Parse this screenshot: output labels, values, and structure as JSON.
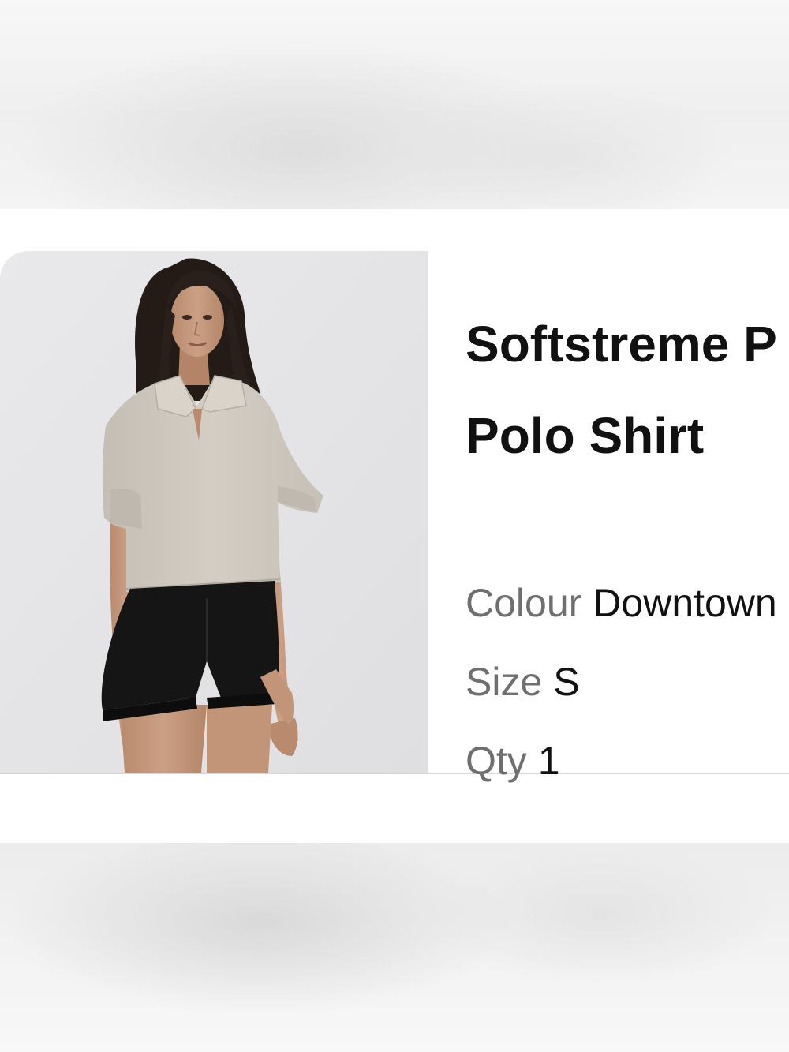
{
  "product": {
    "title_line1": "Softstreme P",
    "title_line2": "Polo Shirt",
    "image_alt": "Model wearing a cropped beige polo shirt with black shorts",
    "attributes": {
      "colour_label": "Colour",
      "colour_value": "Downtown",
      "size_label": "Size",
      "size_value": "S",
      "qty_label": "Qty",
      "qty_value": "1"
    }
  },
  "colors": {
    "image_background": "#e7e7e9",
    "shirt": "#cdc7bd",
    "shorts": "#151515",
    "label_grey": "#6f6f6f",
    "text_dark": "#111111",
    "divider": "#d7d7d7"
  }
}
